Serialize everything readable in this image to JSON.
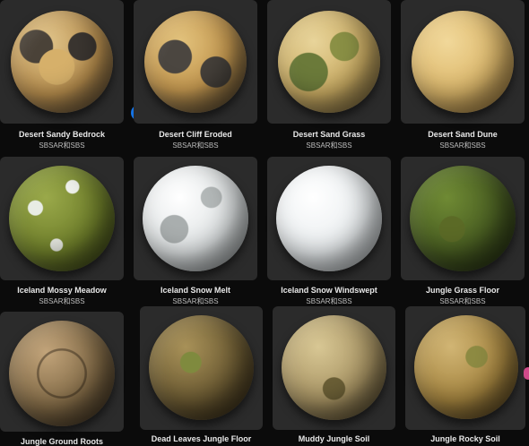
{
  "materials": [
    {
      "title": "Desert Sandy Bedrock",
      "subtitle": "SBSAR和SBS"
    },
    {
      "title": "Desert Cliff Eroded",
      "subtitle": "SBSAR和SBS"
    },
    {
      "title": "Desert Sand Grass",
      "subtitle": "SBSAR和SBS"
    },
    {
      "title": "Desert Sand Dune",
      "subtitle": "SBSAR和SBS"
    },
    {
      "title": "Iceland Mossy Meadow",
      "subtitle": "SBSAR和SBS"
    },
    {
      "title": "Iceland Snow Melt",
      "subtitle": "SBSAR和SBS"
    },
    {
      "title": "Iceland Snow Windswept",
      "subtitle": "SBSAR和SBS"
    },
    {
      "title": "Jungle Grass Floor",
      "subtitle": "SBSAR和SBS"
    },
    {
      "title": "Jungle Ground Roots",
      "subtitle": ""
    },
    {
      "title": "Dead Leaves Jungle Floor",
      "subtitle": ""
    },
    {
      "title": "Muddy Jungle Soil",
      "subtitle": ""
    },
    {
      "title": "Jungle Rocky Soil",
      "subtitle": ""
    }
  ],
  "download_button": {
    "icon": "download-icon",
    "color": "#1473e6"
  },
  "colors": {
    "background": "#0b0b0b",
    "card": "#2b2b2b",
    "accent": "#1473e6"
  }
}
